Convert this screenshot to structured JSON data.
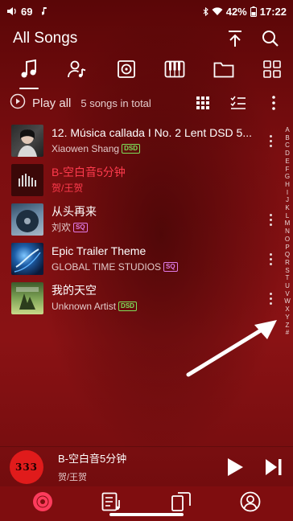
{
  "status_bar": {
    "volume_level": "69",
    "battery": "42%",
    "time": "17:22"
  },
  "header": {
    "title": "All Songs",
    "icons": [
      "sort-top-icon",
      "search-icon"
    ]
  },
  "tabs": [
    {
      "name": "songs",
      "icon": "music-note-icon",
      "active": true
    },
    {
      "name": "artists",
      "icon": "artist-icon",
      "active": false
    },
    {
      "name": "albums",
      "icon": "album-icon",
      "active": false
    },
    {
      "name": "genres",
      "icon": "piano-icon",
      "active": false
    },
    {
      "name": "folders",
      "icon": "folder-icon",
      "active": false
    },
    {
      "name": "more",
      "icon": "grid-icon",
      "active": false
    }
  ],
  "play_all": {
    "label": "Play all",
    "count": "5 songs in total"
  },
  "songs": [
    {
      "title": "12. Música callada I No. 2  Lent DSD 5...",
      "artist": "Xiaowen Shang",
      "badge": "DSD",
      "badge_type": "dsd",
      "playing": false
    },
    {
      "title": "B-空白音5分钟",
      "artist": "贺/王贺",
      "badge": "",
      "badge_type": "",
      "playing": true
    },
    {
      "title": "从头再来",
      "artist": "刘欢",
      "badge": "SQ",
      "badge_type": "sq",
      "playing": false
    },
    {
      "title": "Epic Trailer Theme",
      "artist": "GLOBAL TIME STUDIOS",
      "badge": "SQ",
      "badge_type": "sq",
      "playing": false
    },
    {
      "title": "我的天空",
      "artist": "Unknown Artist",
      "badge": "DSD",
      "badge_type": "dsd",
      "playing": false
    }
  ],
  "alphabet": [
    "A",
    "B",
    "C",
    "D",
    "E",
    "F",
    "G",
    "H",
    "I",
    "J",
    "K",
    "L",
    "M",
    "N",
    "O",
    "P",
    "Q",
    "R",
    "S",
    "T",
    "U",
    "V",
    "W",
    "X",
    "Y",
    "Z",
    "#"
  ],
  "now_playing": {
    "title": "B-空白音5分钟",
    "artist": "贺/王贺",
    "art_text": "333"
  },
  "bottom_nav": [
    "disc-icon",
    "playlist-icon",
    "device-icon",
    "profile-icon"
  ],
  "colors": {
    "background": "#7b0e10",
    "accent_playing": "#ff3b4d",
    "dsd_badge": "#7ee05a",
    "sq_badge": "#e07ae6"
  }
}
